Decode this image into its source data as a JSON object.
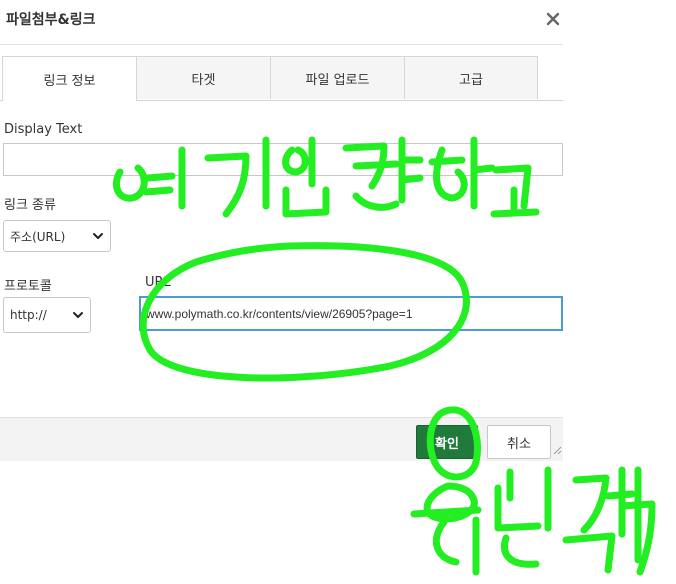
{
  "dialog": {
    "title": "파일첨부&링크",
    "close_icon": "close-icon"
  },
  "tabs": [
    {
      "label": "링크 정보",
      "active": true
    },
    {
      "label": "타겟",
      "active": false
    },
    {
      "label": "파일 업로드",
      "active": false
    },
    {
      "label": "고급",
      "active": false
    }
  ],
  "form": {
    "display_text_label": "Display Text",
    "display_text_value": "",
    "link_type_label": "링크 종류",
    "link_type_value": "주소(URL)",
    "protocol_label": "프로토콜",
    "protocol_value": "http://",
    "url_label": "URL",
    "url_value": "www.polymath.co.kr/contents/view/26905?page=1"
  },
  "footer": {
    "ok_label": "확인",
    "cancel_label": "취소"
  },
  "colors": {
    "ok_button": "#1f7a3c",
    "focus_border": "#4a9bd6",
    "annotation": "#22ee22"
  },
  "annotations": {
    "note_top": "여기 입력하고",
    "note_bottom": "확인클릭"
  }
}
